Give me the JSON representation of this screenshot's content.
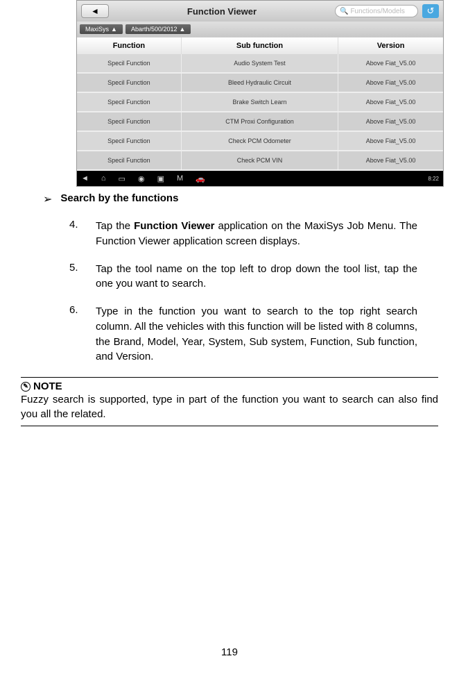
{
  "screenshot": {
    "title": "Function Viewer",
    "search_placeholder": "Functions/Models",
    "tabs": [
      "MaxiSys",
      "Abarth/500/2012"
    ],
    "columns": [
      "Function",
      "Sub function",
      "Version"
    ],
    "rows": [
      {
        "fn": "Specil Function",
        "sub": "Audio System Test",
        "ver": "Above Fiat_V5.00"
      },
      {
        "fn": "Specil Function",
        "sub": "Bleed Hydraulic Circuit",
        "ver": "Above Fiat_V5.00"
      },
      {
        "fn": "Specil Function",
        "sub": "Brake Switch Learn",
        "ver": "Above Fiat_V5.00"
      },
      {
        "fn": "Specil Function",
        "sub": "CTM Proxi Configuration",
        "ver": "Above Fiat_V5.00"
      },
      {
        "fn": "Specil Function",
        "sub": "Check PCM Odometer",
        "ver": "Above Fiat_V5.00"
      },
      {
        "fn": "Specil Function",
        "sub": "Check PCM VIN",
        "ver": "Above Fiat_V5.00"
      }
    ],
    "footer_time": "8:22"
  },
  "bullet": {
    "text": "Search by the functions"
  },
  "steps": [
    {
      "num": "4.",
      "pre": "Tap the ",
      "bold": "Function Viewer",
      "post": " application on the MaxiSys Job Menu. The Function Viewer application screen displays."
    },
    {
      "num": "5.",
      "pre": "Tap the tool name on the top left to drop down the tool list, tap the one you want to search.",
      "bold": "",
      "post": ""
    },
    {
      "num": "6.",
      "pre": "Type in the function you want to search to the top right search column. All the vehicles with this function will be listed with 8 columns, the Brand, Model, Year, System, Sub system, Function, Sub function, and Version.",
      "bold": "",
      "post": ""
    }
  ],
  "note": {
    "label": "NOTE",
    "text": "Fuzzy search is supported, type in part of the function you want to search can also find you all the related."
  },
  "page_number": "119"
}
